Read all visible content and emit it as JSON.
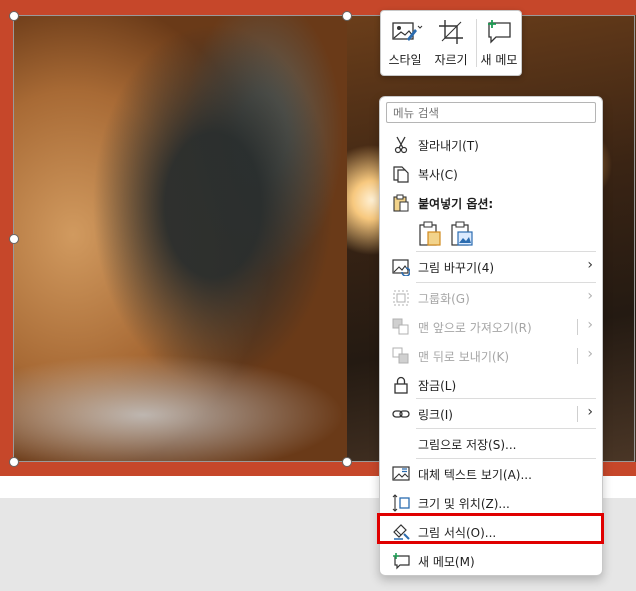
{
  "minibar": {
    "style_label": "스타일",
    "crop_label": "자르기",
    "new_comment_label": "새 메모"
  },
  "menu": {
    "search_placeholder": "메뉴 검색",
    "items": [
      {
        "label": "잘라내기(T)",
        "icon": "scissors-icon"
      },
      {
        "label": "복사(C)",
        "icon": "copy-icon"
      },
      {
        "label": "붙여넣기 옵션:",
        "icon": "paste-icon"
      },
      {
        "label": "그림 바꾸기(4)",
        "icon": "change-picture-icon"
      },
      {
        "label": "그룹화(G)",
        "icon": "group-icon"
      },
      {
        "label": "맨 앞으로 가져오기(R)",
        "icon": "bring-to-front-icon"
      },
      {
        "label": "맨 뒤로 보내기(K)",
        "icon": "send-to-back-icon"
      },
      {
        "label": "잠금(L)",
        "icon": "lock-icon"
      },
      {
        "label": "링크(I)",
        "icon": "link-icon"
      },
      {
        "label": "그림으로 저장(S)...",
        "icon": ""
      },
      {
        "label": "대체 텍스트 보기(A)...",
        "icon": "alt-text-icon"
      },
      {
        "label": "크기 및 위치(Z)...",
        "icon": "size-position-icon"
      },
      {
        "label": "그림 서식(O)...",
        "icon": "format-picture-icon"
      },
      {
        "label": "새 메모(M)",
        "icon": "new-comment-icon"
      }
    ]
  },
  "colors": {
    "slide_band": "#c6472a",
    "highlight": "#e00000",
    "icon_blue": "#2b6cb0",
    "icon_orange": "#d08a1e"
  }
}
